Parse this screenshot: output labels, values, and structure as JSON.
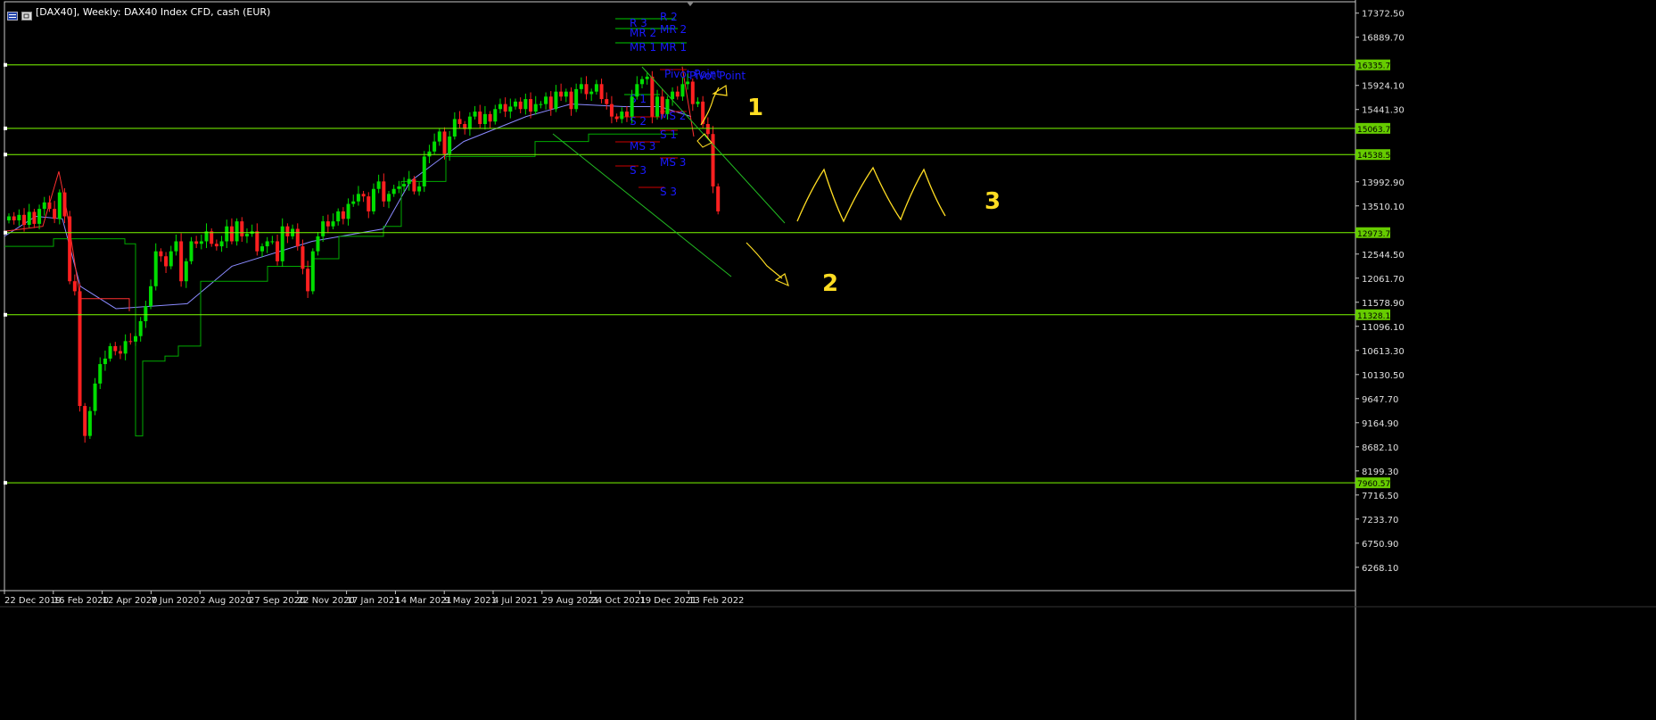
{
  "window": {
    "title": "[DAX40], Weekly:  DAX40 Index CFD, cash (EUR)"
  },
  "chart_data": {
    "type": "candlestick",
    "symbol": "DAX40",
    "timeframe": "Weekly",
    "description": "DAX40 Index CFD, cash (EUR)",
    "grid": false,
    "ylim": [
      5800,
      17600
    ],
    "x_ticks": [
      "22 Dec 2019",
      "16 Feb 2020",
      "12 Apr 2020",
      "7 Jun 2020",
      "2 Aug 2020",
      "27 Sep 2020",
      "22 Nov 2020",
      "17 Jan 2021",
      "14 Mar 2021",
      "9 May 2021",
      "4 Jul 2021",
      "29 Aug 2021",
      "24 Oct 2021",
      "19 Dec 2021",
      "13 Feb 2022"
    ],
    "y_ticks": [
      "17372.50",
      "16889.70",
      "15924.10",
      "15441.30",
      "13992.90",
      "13510.10",
      "12544.50",
      "12061.70",
      "11578.90",
      "11096.10",
      "10613.30",
      "10130.50",
      "9647.70",
      "9164.90",
      "8682.10",
      "8199.30",
      "7716.50",
      "7233.70",
      "6750.90",
      "6268.10"
    ],
    "horizontal_levels": [
      "16335.78",
      "15063.79",
      "14538.59",
      "12973.74",
      "11328.19",
      "7960.57"
    ],
    "closes": [
      13300,
      13220,
      13330,
      13130,
      13390,
      13150,
      13450,
      13580,
      13450,
      13250,
      13780,
      13300,
      12000,
      11800,
      9500,
      8900,
      9400,
      9950,
      10340,
      10450,
      10700,
      10600,
      10550,
      10800,
      10790,
      10900,
      11200,
      11500,
      11900,
      12600,
      12500,
      12300,
      12600,
      12800,
      12000,
      12400,
      12800,
      12750,
      12800,
      13000,
      12750,
      12700,
      12800,
      13100,
      12800,
      13200,
      12900,
      12950,
      13000,
      12600,
      12700,
      12800,
      12800,
      12400,
      13100,
      12900,
      13050,
      12700,
      12250,
      11800,
      12600,
      12900,
      13200,
      13100,
      13200,
      13400,
      13250,
      13550,
      13600,
      13750,
      13700,
      13400,
      13850,
      14000,
      13600,
      13750,
      13850,
      13900,
      13950,
      14050,
      13800,
      13900,
      14500,
      14600,
      14800,
      15000,
      14550,
      14900,
      15250,
      15150,
      15050,
      15300,
      15400,
      15150,
      15350,
      15200,
      15450,
      15550,
      15400,
      15500,
      15600,
      15450,
      15650,
      15400,
      15550,
      15550,
      15700,
      15450,
      15800,
      15700,
      15800,
      15450,
      15850,
      15950,
      15750,
      15800,
      15950,
      15650,
      15550,
      15300,
      15250,
      15400,
      15300,
      15700,
      15950,
      16050,
      16100,
      15300,
      15700,
      15350,
      15650,
      15800,
      15700,
      15950,
      16000,
      15550,
      15600,
      15150,
      14950,
      13900,
      13400
    ],
    "series": [
      {
        "name": "R 3"
      },
      {
        "name": "R 2"
      },
      {
        "name": "MR 2"
      },
      {
        "name": "MR 1"
      },
      {
        "name": "Pivot Point"
      },
      {
        "name": "S 1"
      },
      {
        "name": "MS 2"
      },
      {
        "name": "S 2"
      },
      {
        "name": "MS 3"
      },
      {
        "name": "S 3"
      }
    ],
    "annotations": [
      "1",
      "2",
      "3"
    ],
    "colors": {
      "up": "#00dd00",
      "down": "#ff2020",
      "level": "#7cfc00",
      "label_bg": "#66cc00",
      "pivot_text": "#1a1aff",
      "drawing": "#ffdd22",
      "ma_blue": "#8a8aff",
      "ma_red": "#ff3030",
      "ma_green": "#00aa00"
    }
  }
}
